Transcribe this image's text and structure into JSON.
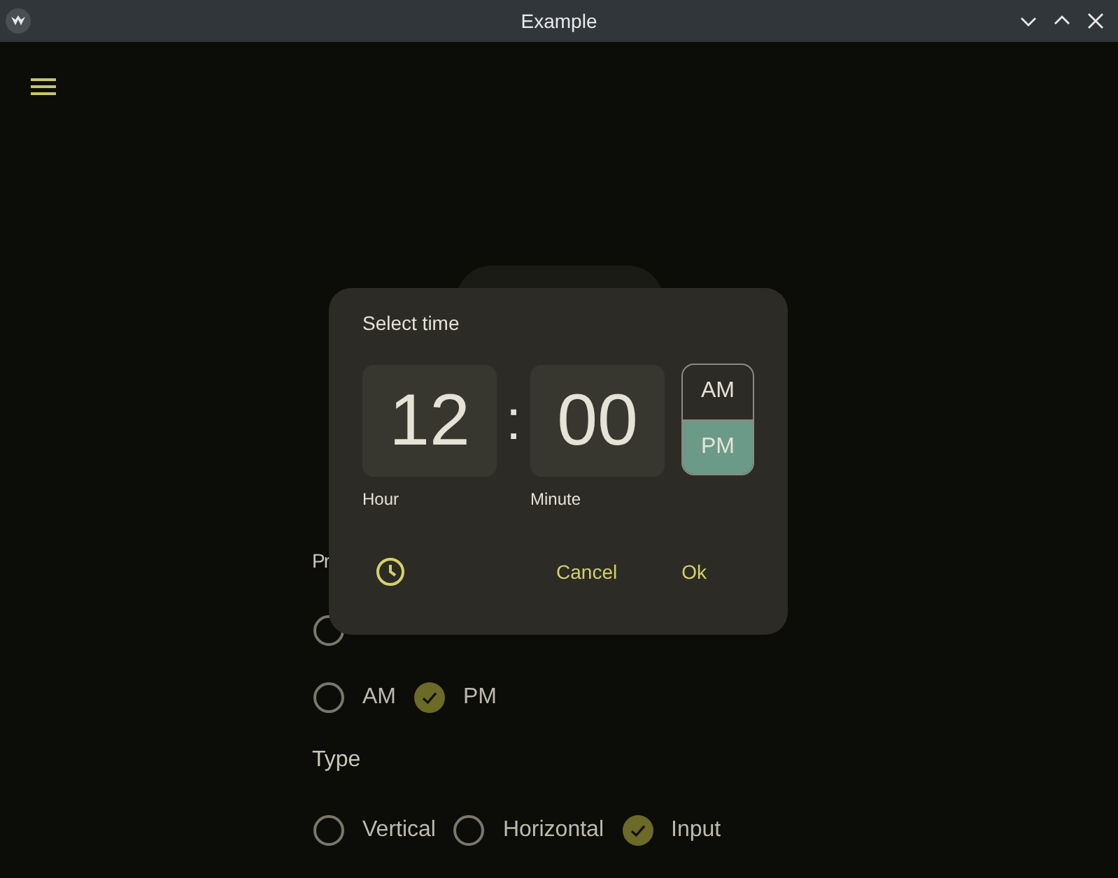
{
  "window": {
    "title": "Example"
  },
  "preset": {
    "heading": "Pr",
    "current_time": {
      "selected": false
    },
    "options": [
      {
        "label": "AM",
        "selected": false
      },
      {
        "label": "PM",
        "selected": true
      }
    ]
  },
  "type": {
    "heading": "Type",
    "options": [
      {
        "label": "Vertical",
        "selected": false
      },
      {
        "label": "Horizontal",
        "selected": false
      },
      {
        "label": "Input",
        "selected": true
      }
    ]
  },
  "dialog": {
    "title": "Select time",
    "hour": {
      "value": "12",
      "label": "Hour"
    },
    "separator": ":",
    "minute": {
      "value": "00",
      "label": "Minute"
    },
    "period": [
      {
        "label": "AM",
        "selected": false
      },
      {
        "label": "PM",
        "selected": true
      }
    ],
    "buttons": [
      "Cancel",
      "Ok"
    ]
  }
}
